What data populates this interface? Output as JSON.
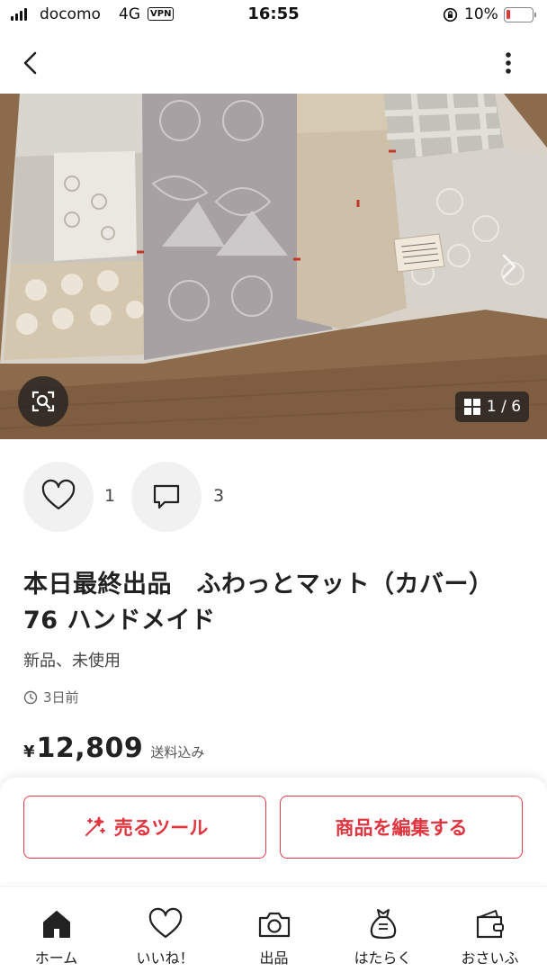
{
  "status_bar": {
    "carrier": "docomo",
    "network": "4G",
    "vpn": "VPN",
    "time": "16:55",
    "battery_percent": "10%",
    "battery_level": 0.1,
    "battery_color": "#e53935"
  },
  "nav": {
    "back_icon": "chevron-left-icon",
    "more_icon": "vertical-ellipsis-icon"
  },
  "gallery": {
    "counter": "1 / 6",
    "current": 1,
    "total": 6,
    "scan_icon": "image-search-icon",
    "grid_icon": "grid-icon",
    "next_icon": "chevron-right-icon"
  },
  "reactions": {
    "likes": "1",
    "comments": "3",
    "like_icon": "heart-icon",
    "comment_icon": "comment-icon"
  },
  "item": {
    "title": "本日最終出品　ふわっとマット（カバー）76 ハンドメイド",
    "condition": "新品、未使用",
    "posted": "3日前",
    "currency": "¥",
    "price": "12,809",
    "shipping": "送料込み"
  },
  "actions": {
    "sell_tool": "売るツール",
    "edit_item": "商品を編集する",
    "accent": "#e0353f"
  },
  "tabbar": {
    "items": [
      {
        "label": "ホーム",
        "icon": "home-icon"
      },
      {
        "label": "いいね！",
        "icon": "heart-icon"
      },
      {
        "label": "出品",
        "icon": "camera-icon"
      },
      {
        "label": "はたらく",
        "icon": "money-bag-icon"
      },
      {
        "label": "おさいふ",
        "icon": "wallet-icon"
      }
    ]
  }
}
